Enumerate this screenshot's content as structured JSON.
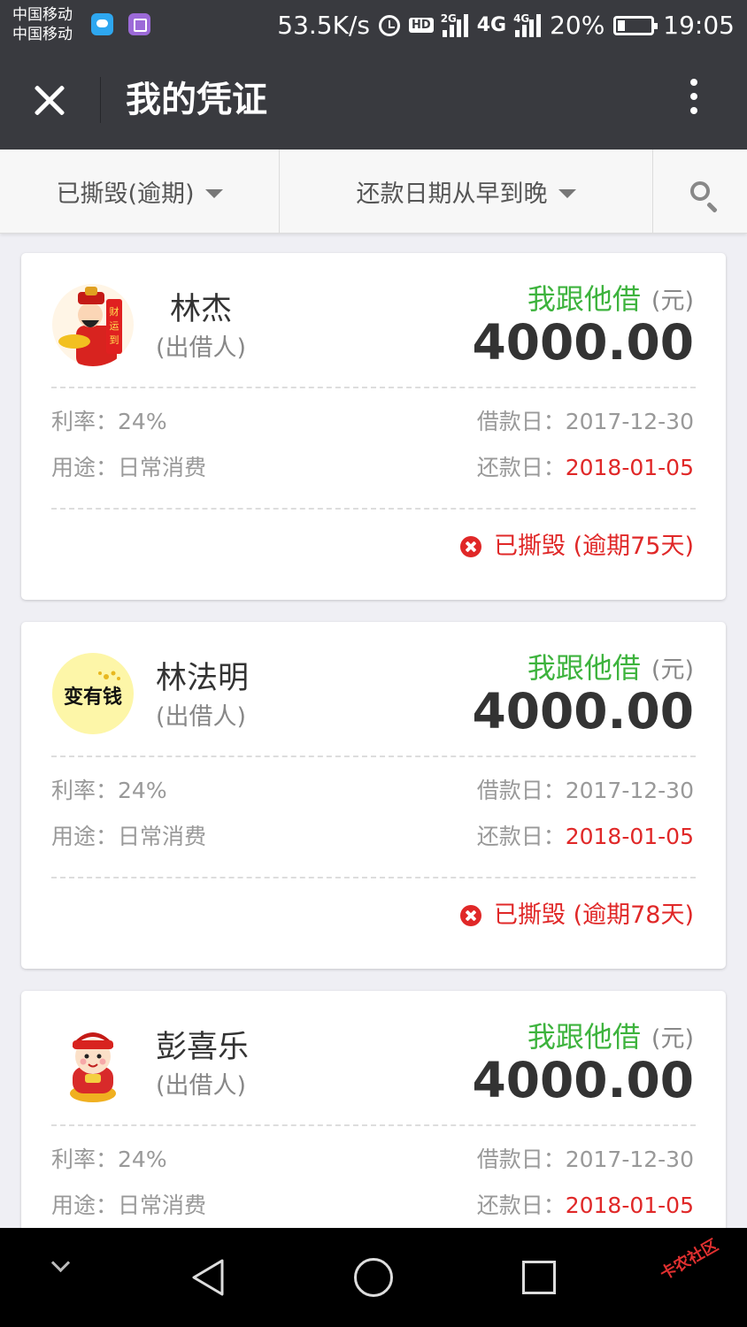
{
  "status_bar": {
    "carrier_1": "中国移动",
    "carrier_2": "中国移动",
    "net_speed": "53.5K/s",
    "hd": "HD",
    "net_2g": "2G",
    "net_4g": "4G",
    "net_4g_small": "4G",
    "battery": "20%",
    "time": "19:05"
  },
  "header": {
    "title": "我的凭证"
  },
  "filters": {
    "status_filter": "已撕毁(逾期)",
    "sort_filter": "还款日期从早到晚"
  },
  "labels": {
    "role": "(出借人)",
    "loan_type": "我跟他借",
    "unit": "(元)",
    "rate": "利率：",
    "purpose": "用途：",
    "loan_date": "借款日：",
    "due_date": "还款日："
  },
  "vouchers": [
    {
      "name": "林杰",
      "amount": "4000.00",
      "rate": "24%",
      "purpose": "日常消费",
      "loan_date": "2017-12-30",
      "due_date": "2018-01-05",
      "status": "已撕毁 (逾期75天)",
      "avatar": "caishen-avatar"
    },
    {
      "name": "林法明",
      "amount": "4000.00",
      "rate": "24%",
      "purpose": "日常消费",
      "loan_date": "2017-12-30",
      "due_date": "2018-01-05",
      "status": "已撕毁 (逾期78天)",
      "avatar": "text-avatar",
      "avatar_text": "变有钱"
    },
    {
      "name": "彭喜乐",
      "amount": "4000.00",
      "rate": "24%",
      "purpose": "日常消费",
      "loan_date": "2017-12-30",
      "due_date": "2018-01-05",
      "status": "",
      "avatar": "cartoon-avatar"
    }
  ],
  "watermark": "卡农社区",
  "colors": {
    "header_bg": "#393a3f",
    "green": "#3db33d",
    "red": "#e02828"
  }
}
